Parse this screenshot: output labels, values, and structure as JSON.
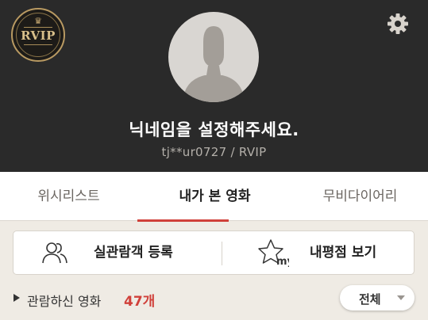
{
  "profile": {
    "badge_text": "RVIP",
    "nickname_prompt": "닉네임을 설정해주세요.",
    "user_id_grade": "tj**ur0727 / RVIP"
  },
  "tabs": [
    {
      "label": "위시리스트",
      "active": false
    },
    {
      "label": "내가 본 영화",
      "active": true
    },
    {
      "label": "무비다이어리",
      "active": false
    }
  ],
  "actions": {
    "register_label": "실관람객 등록",
    "review_label": "내평점 보기",
    "review_icon_text": "my"
  },
  "watched": {
    "label": "관람하신 영화",
    "count": "47개",
    "filter_selected": "전체"
  },
  "icons": [
    "gear-icon",
    "avatar-silhouette-icon",
    "people-icon",
    "star-my-icon",
    "play-triangle-icon",
    "chevron-down-icon"
  ],
  "colors": {
    "header_bg": "#2a2a2a",
    "accent": "#d0403a",
    "page_bg": "#efebe4",
    "gold": "#b99a62"
  }
}
